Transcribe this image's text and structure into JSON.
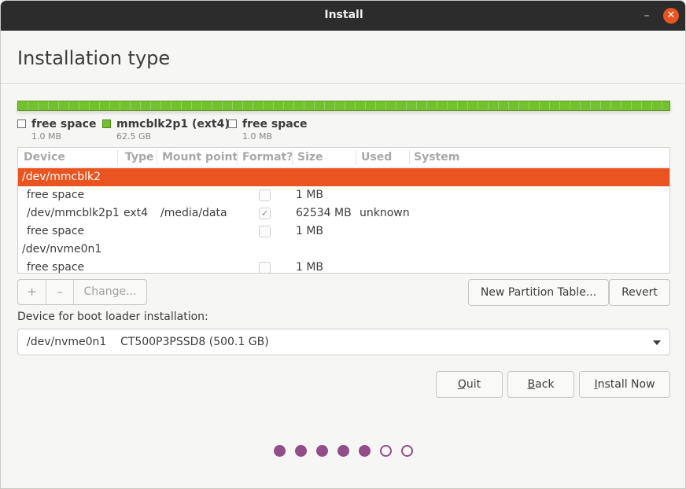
{
  "window": {
    "title": "Install"
  },
  "header": {
    "title": "Installation type"
  },
  "legend": [
    {
      "name": "free space",
      "size": "1.0 MB",
      "kind": "free"
    },
    {
      "name": "mmcblk2p1 (ext4)",
      "size": "62.5 GB",
      "kind": "ext4"
    },
    {
      "name": "free space",
      "size": "1.0 MB",
      "kind": "free"
    }
  ],
  "colors": {
    "accent": "#e95420",
    "ext4": "#73c12e",
    "progress": "#924d8b"
  },
  "table": {
    "columns": [
      "Device",
      "Type",
      "Mount point",
      "Format?",
      "Size",
      "Used",
      "System"
    ],
    "rows": [
      {
        "device": "/dev/mmcblk2",
        "type": "",
        "mount": "",
        "format": null,
        "size": "",
        "used": "",
        "system": "",
        "selected": true,
        "indent": false
      },
      {
        "device": "free space",
        "type": "",
        "mount": "",
        "format": false,
        "size": "1 MB",
        "used": "",
        "system": "",
        "selected": false,
        "indent": true
      },
      {
        "device": "/dev/mmcblk2p1",
        "type": "ext4",
        "mount": "/media/data",
        "format": true,
        "size": "62534 MB",
        "used": "unknown",
        "system": "",
        "selected": false,
        "indent": true
      },
      {
        "device": "free space",
        "type": "",
        "mount": "",
        "format": false,
        "size": "1 MB",
        "used": "",
        "system": "",
        "selected": false,
        "indent": true
      },
      {
        "device": "/dev/nvme0n1",
        "type": "",
        "mount": "",
        "format": null,
        "size": "",
        "used": "",
        "system": "",
        "selected": false,
        "indent": false
      },
      {
        "device": "free space",
        "type": "",
        "mount": "",
        "format": false,
        "size": "1 MB",
        "used": "",
        "system": "",
        "selected": false,
        "indent": true
      }
    ]
  },
  "toolbar": {
    "add_label": "+",
    "remove_label": "–",
    "change_label": "Change...",
    "new_table_label": "New Partition Table...",
    "revert_label": "Revert"
  },
  "bootloader": {
    "label": "Device for boot loader installation:",
    "device": "/dev/nvme0n1",
    "model": "CT500P3PSSD8 (500.1 GB)"
  },
  "actions": {
    "quit_label": "Quit",
    "back_label": "Back",
    "install_label": "Install Now"
  },
  "progress": {
    "total_steps": 7,
    "completed_steps": 5
  }
}
